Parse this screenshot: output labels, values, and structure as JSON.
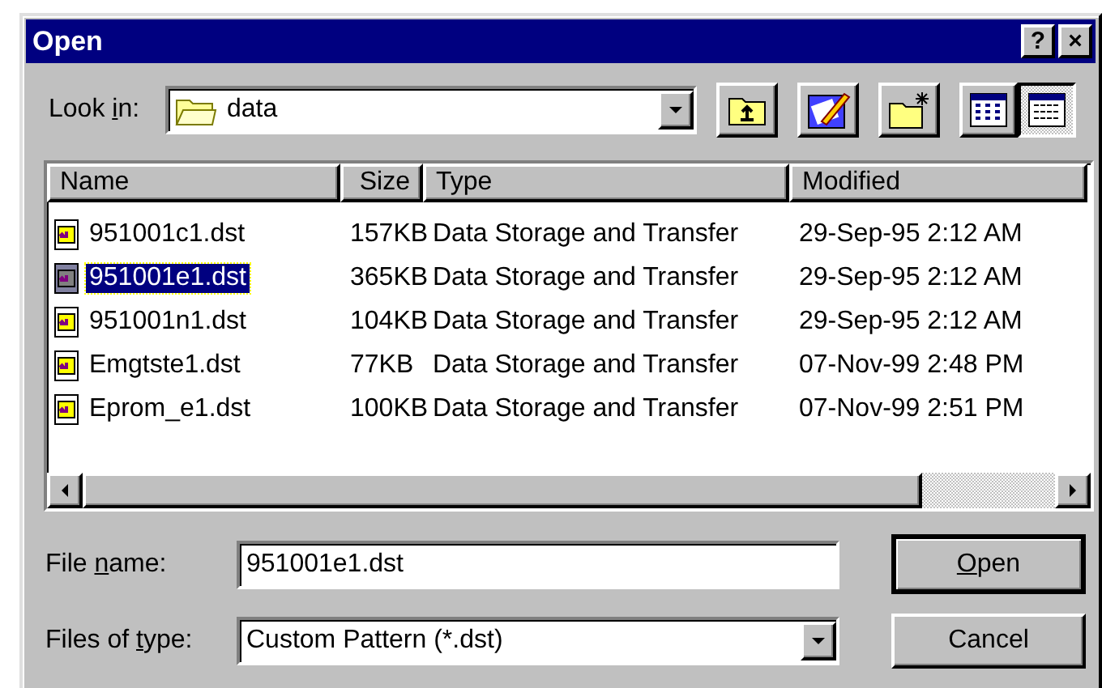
{
  "window": {
    "title": "Open",
    "buttons": [
      {
        "kind": "help",
        "label": "?"
      },
      {
        "kind": "close",
        "label": "×"
      }
    ]
  },
  "look_in": {
    "label_parts": [
      {
        "text": "Look ",
        "underlined": false
      },
      {
        "text": "i",
        "underlined": true
      },
      {
        "text": "n:",
        "underlined": false
      }
    ],
    "value": "data"
  },
  "view_modes": [
    {
      "kind": "list",
      "selected": false
    },
    {
      "kind": "details",
      "selected": true
    }
  ],
  "table": {
    "columns": [
      "Name",
      "Size",
      "Type",
      "Modified"
    ],
    "rows": [
      {
        "name": "951001c1.dst",
        "size": "157KB",
        "type": "Data Storage and Transfer",
        "modified": "29-Sep-95 2:12 AM",
        "selected": false
      },
      {
        "name": "951001e1.dst",
        "size": "365KB",
        "type": "Data Storage and Transfer",
        "modified": "29-Sep-95 2:12 AM",
        "selected": true
      },
      {
        "name": "951001n1.dst",
        "size": "104KB",
        "type": "Data Storage and Transfer",
        "modified": "29-Sep-95 2:12 AM",
        "selected": false
      },
      {
        "name": "Emgtste1.dst",
        "size": "77KB",
        "type": "Data Storage and Transfer",
        "modified": "07-Nov-99 2:48 PM",
        "selected": false
      },
      {
        "name": "Eprom_e1.dst",
        "size": "100KB",
        "type": "Data Storage and Transfer",
        "modified": "07-Nov-99 2:51 PM",
        "selected": false
      }
    ]
  },
  "file_name": {
    "label_parts": [
      {
        "text": "File ",
        "underlined": false
      },
      {
        "text": "n",
        "underlined": true
      },
      {
        "text": "ame:",
        "underlined": false
      }
    ],
    "value": "951001e1.dst"
  },
  "file_type": {
    "label_parts": [
      {
        "text": "Files of ",
        "underlined": false
      },
      {
        "text": "t",
        "underlined": true
      },
      {
        "text": "ype:",
        "underlined": false
      }
    ],
    "value": "Custom Pattern (*.dst)"
  },
  "buttons": [
    {
      "kind": "default",
      "label_parts": [
        {
          "text": "O",
          "underlined": true
        },
        {
          "text": "pen",
          "underlined": false
        }
      ]
    },
    {
      "kind": "normal",
      "label_parts": [
        {
          "text": "Cancel",
          "underlined": false
        }
      ]
    }
  ]
}
